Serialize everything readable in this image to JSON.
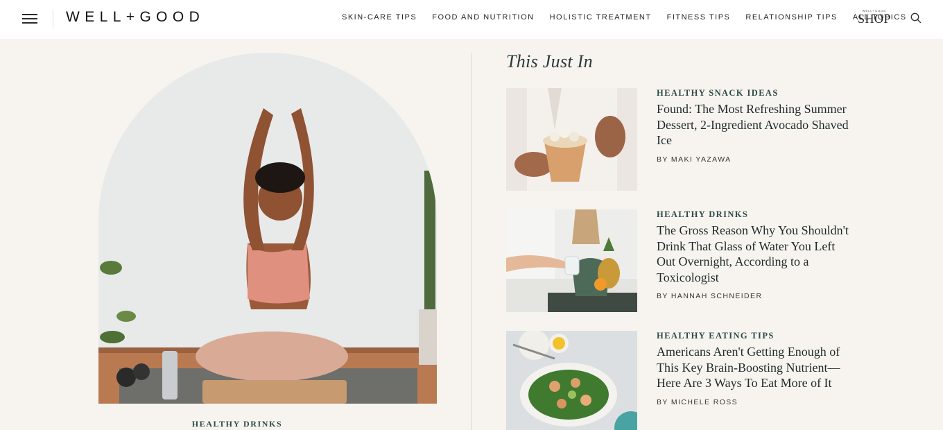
{
  "header": {
    "logo": "WELL+GOOD",
    "nav": [
      "SKIN-CARE TIPS",
      "FOOD AND NUTRITION",
      "HOLISTIC TREATMENT",
      "FITNESS TIPS",
      "RELATIONSHIP TIPS",
      "ALL TOPICS"
    ],
    "shop_small": "WELL+GOOD",
    "shop_label": "SHOP"
  },
  "hero": {
    "category": "HEALTHY DRINKS"
  },
  "section": {
    "title": "This Just In"
  },
  "articles": [
    {
      "category": "HEALTHY SNACK IDEAS",
      "headline": "Found: The Most Refreshing Summer Dessert, 2-Ingredient Avocado Shaved Ice",
      "byline": "BY MAKI YAZAWA"
    },
    {
      "category": "HEALTHY DRINKS",
      "headline": "The Gross Reason Why You Shouldn't Drink That Glass of Water You Left Out Overnight, According to a Toxicologist",
      "byline": "BY HANNAH SCHNEIDER"
    },
    {
      "category": "HEALTHY EATING TIPS",
      "headline": "Americans Aren't Getting Enough of This Key Brain-Boosting Nutrient—Here Are 3 Ways To Eat More of It",
      "byline": "BY MICHELE ROSS"
    }
  ],
  "icons": {
    "menu": "hamburger-icon",
    "search": "search-icon"
  }
}
